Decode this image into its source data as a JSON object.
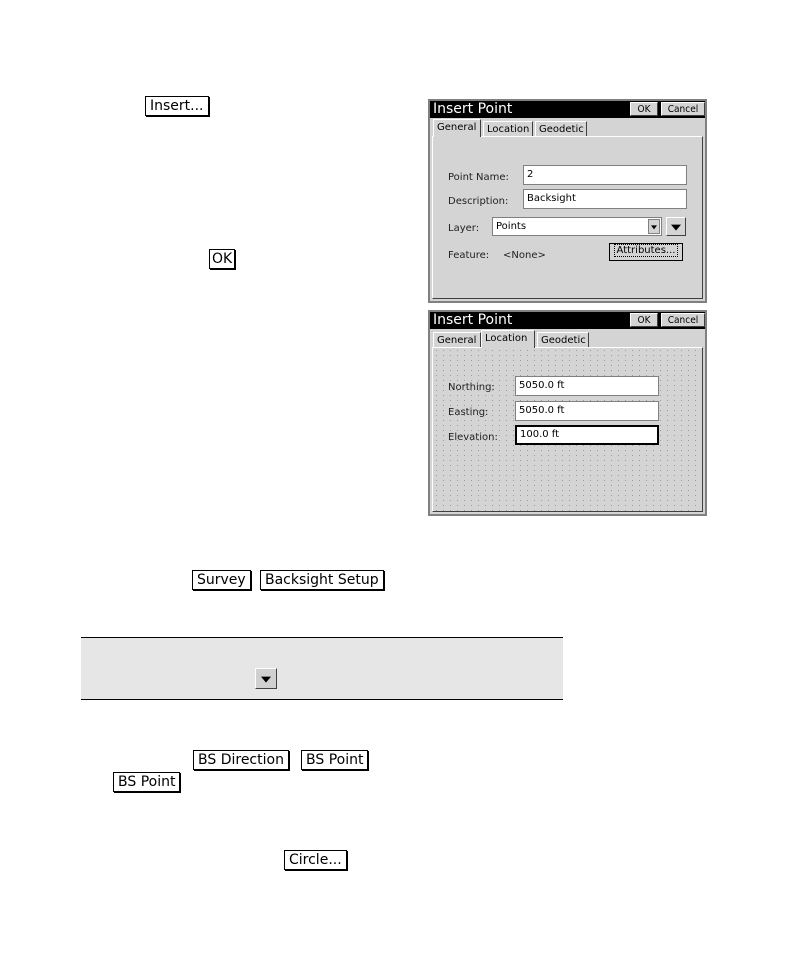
{
  "doc_buttons": {
    "insert": "Insert...",
    "ok": "OK",
    "survey": "Survey",
    "backsight_setup": "Backsight Setup",
    "bs_direction": "BS Direction",
    "bs_point": "BS Point",
    "bs_point_2": "BS Point",
    "circle": "Circle..."
  },
  "dialog_general": {
    "title": "Insert Point",
    "ok_label": "OK",
    "cancel_label": "Cancel",
    "tabs": [
      "General",
      "Location",
      "Geodetic"
    ],
    "active_tab": "General",
    "point_name_label": "Point Name:",
    "point_name_value": "2",
    "description_label": "Description:",
    "description_value": "Backsight",
    "layer_label": "Layer:",
    "layer_value": "Points",
    "feature_label": "Feature:",
    "feature_value": "<None>",
    "attributes_label": "Attributes..."
  },
  "dialog_location": {
    "title": "Insert Point",
    "ok_label": "OK",
    "cancel_label": "Cancel",
    "tabs": [
      "General",
      "Location",
      "Geodetic"
    ],
    "active_tab": "Location",
    "northing_label": "Northing:",
    "northing_value": "5050.0 ft",
    "easting_label": "Easting:",
    "easting_value": "5050.0 ft",
    "elevation_label": "Elevation:",
    "elevation_value": "100.0 ft"
  },
  "icons": {
    "band_button": "chevron-down-icon",
    "layer_dropdown": "dropdown-arrow-icon"
  }
}
